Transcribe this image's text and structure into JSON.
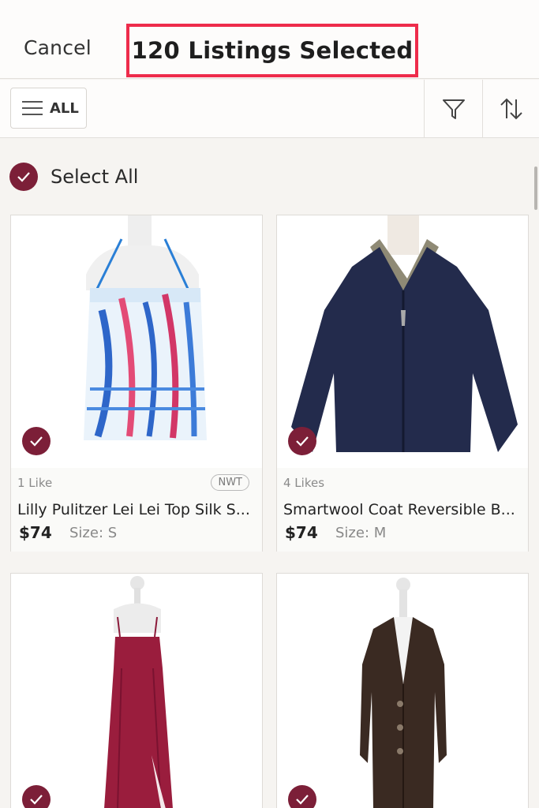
{
  "header": {
    "cancel_label": "Cancel",
    "title": "120 Listings Selected"
  },
  "toolbar": {
    "all_label": "ALL",
    "filter_icon": "filter-icon",
    "sort_icon": "sort-icon"
  },
  "select_all": {
    "label": "Select All",
    "checked": true
  },
  "colors": {
    "accent": "#7c1f38",
    "highlight_box": "#ee2c4b"
  },
  "listings": [
    {
      "likes": "1 Like",
      "badge": "NWT",
      "title": "Lilly Pulitzer Lei Lei Top Silk S...",
      "price": "$74",
      "size": "Size: S",
      "selected": true
    },
    {
      "likes": "4 Likes",
      "badge": "",
      "title": "Smartwool Coat Reversible B...",
      "price": "$74",
      "size": "Size: M",
      "selected": true
    },
    {
      "selected": true
    },
    {
      "selected": true
    }
  ]
}
